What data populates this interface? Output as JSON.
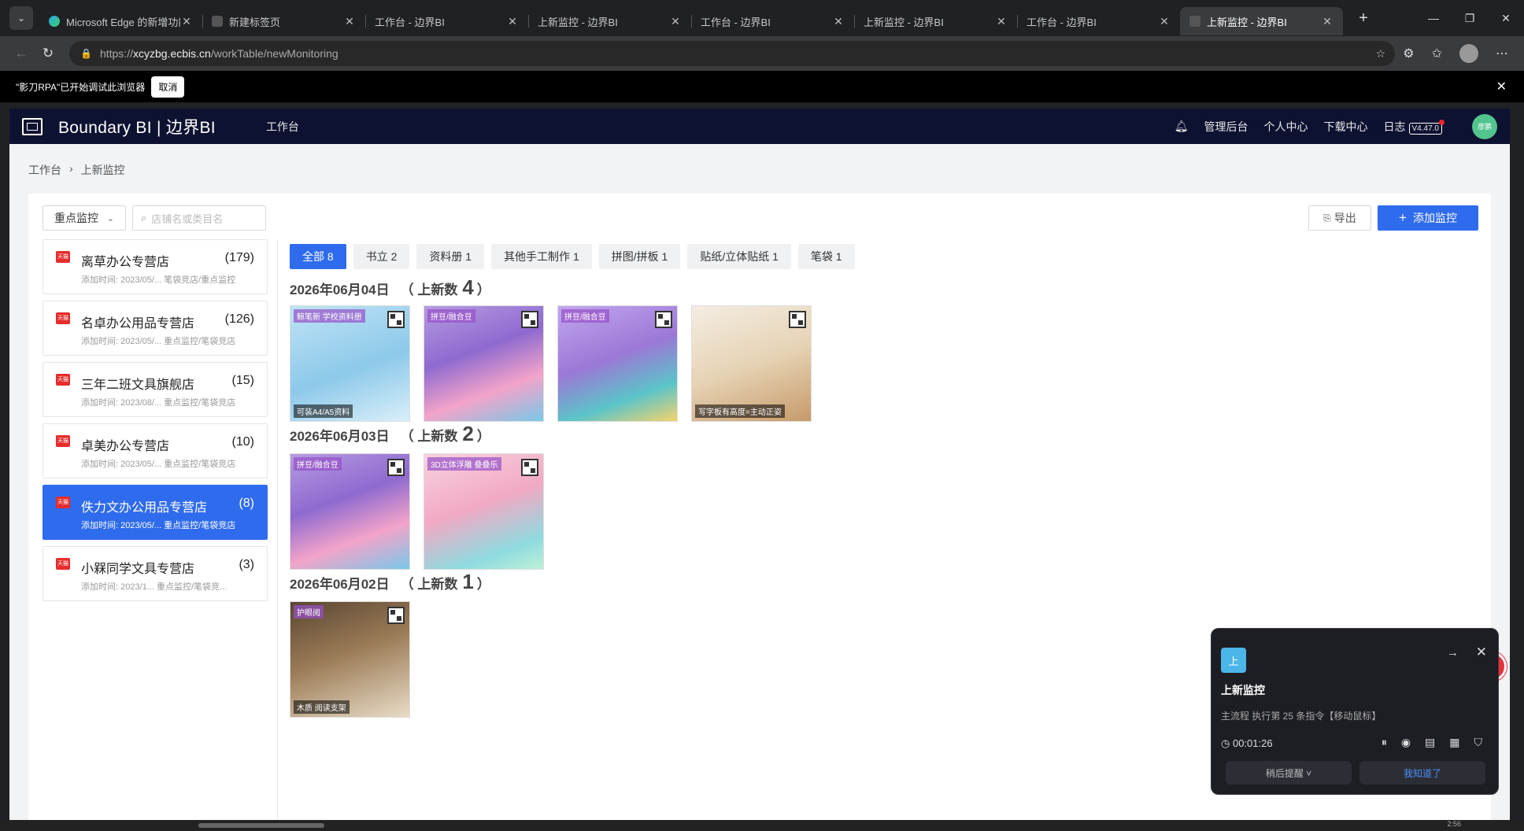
{
  "browser": {
    "tabs": [
      {
        "title": "Microsoft Edge 的新增功能",
        "fav": "edge"
      },
      {
        "title": "新建标签页",
        "fav": "page"
      },
      {
        "title": "工作台 - 边界BI",
        "fav": "none"
      },
      {
        "title": "上新监控 - 边界BI",
        "fav": "none"
      },
      {
        "title": "工作台 - 边界BI",
        "fav": "none"
      },
      {
        "title": "上新监控 - 边界BI",
        "fav": "none"
      },
      {
        "title": "工作台 - 边界BI",
        "fav": "none"
      },
      {
        "title": "上新监控 - 边界BI",
        "fav": "page",
        "active": true
      }
    ],
    "url_prefix": "https://",
    "url_host": "xcyzbg.ecbis.cn",
    "url_path": "/workTable/newMonitoring"
  },
  "infobar": {
    "message": "\"影刀RPA\"已开始调试此浏览器",
    "cancel_label": "取消"
  },
  "header": {
    "brand": "Boundary BI | 边界BI",
    "nav_workbench": "工作台",
    "links": [
      "管理后台",
      "个人中心",
      "下载中心"
    ],
    "log_label": "日志",
    "version": "V4.47.0",
    "user_avatar": "彦鹏"
  },
  "breadcrumb": [
    "工作台",
    "上新监控"
  ],
  "filter": {
    "select_value": "重点监控",
    "search_placeholder": "店铺名或类目名"
  },
  "actions": {
    "export_label": "导出",
    "add_label": "添加监控"
  },
  "stores": [
    {
      "name": "离草办公专营店",
      "count": "(179)",
      "meta": "添加时间: 2023/05/... 笔袋竞店/重点监控",
      "tag": "天猫"
    },
    {
      "name": "名卓办公用品专营店",
      "count": "(126)",
      "meta": "添加时间: 2023/05/... 重点监控/笔袋竞店",
      "tag": "天猫"
    },
    {
      "name": "三年二班文具旗舰店",
      "count": "(15)",
      "meta": "添加时间: 2023/08/... 重点监控/笔袋竞店",
      "tag": "天猫"
    },
    {
      "name": "卓美办公专营店",
      "count": "(10)",
      "meta": "添加时间: 2023/05/... 重点监控/笔袋竞店",
      "tag": "天猫"
    },
    {
      "name": "佚力文办公用品专营店",
      "count": "(8)",
      "meta": "添加时间: 2023/05/... 重点监控/笔袋竞店",
      "tag": "天猫",
      "active": true
    },
    {
      "name": "小槑同学文具专营店",
      "count": "(3)",
      "meta": "添加时间: 2023/1... 重点监控/笔袋竞...",
      "tag": "天猫"
    }
  ],
  "categories": [
    "全部 8",
    "书立 2",
    "资料册 1",
    "其他手工制作 1",
    "拼图/拼板 1",
    "贴纸/立体贴纸 1",
    "笔袋 1"
  ],
  "groups": [
    {
      "date": "2026年06月04日",
      "label_open": "（ 上新数",
      "count": "4",
      "label_close": "）",
      "items": [
        {
          "style": "p1",
          "badge": "鲸笔新 学校资料册",
          "caption": "可装A4/A5资料"
        },
        {
          "style": "p2",
          "badge": "拼豆/融合豆",
          "caption": ""
        },
        {
          "style": "p3",
          "badge": "拼豆/融合豆",
          "caption": ""
        },
        {
          "style": "p4",
          "badge": "",
          "caption": "写字板有高度=主动正姿"
        }
      ]
    },
    {
      "date": "2026年06月03日",
      "label_open": "（ 上新数",
      "count": "2",
      "label_close": "）",
      "items": [
        {
          "style": "p2",
          "badge": "拼豆/融合豆",
          "caption": ""
        },
        {
          "style": "p5",
          "badge": "3D立体浮雕 叠叠乐",
          "caption": ""
        }
      ]
    },
    {
      "date": "2026年06月02日",
      "label_open": "（ 上新数",
      "count": "1",
      "label_close": "）",
      "items": [
        {
          "style": "p6",
          "badge": "护眼阅",
          "caption": "木质 阅读支架"
        }
      ]
    }
  ],
  "rpa": {
    "icon_text": "上",
    "title": "上新监控",
    "step": "主流程 执行第 25 条指令【移动鼠标】",
    "timer": "00:01:26",
    "under_left": "稍后提醒 ˅",
    "under_right": "我知道了"
  },
  "bottom_time": "2:56"
}
